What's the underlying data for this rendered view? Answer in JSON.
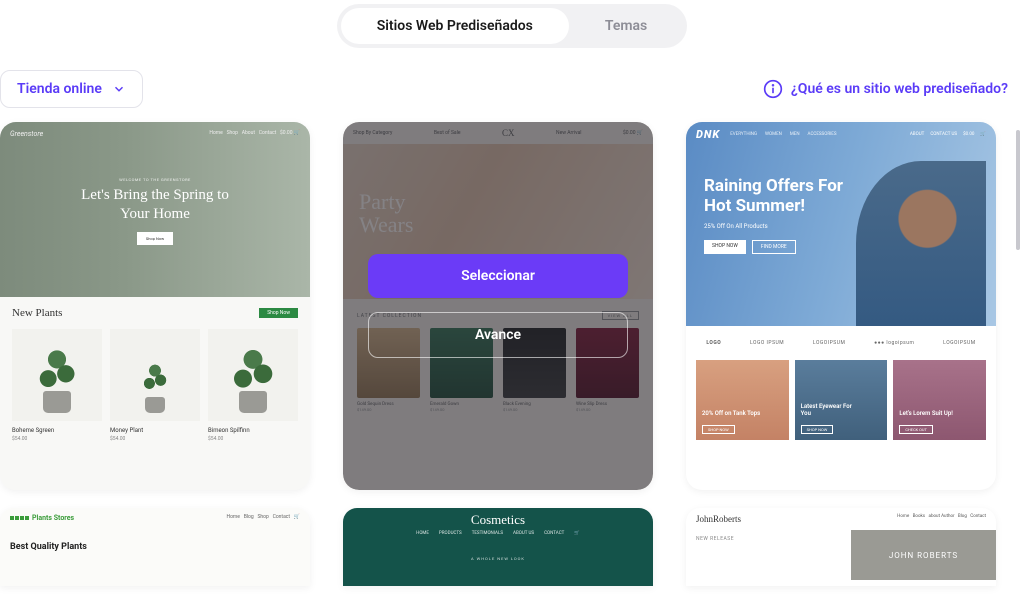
{
  "tabs": {
    "predesigned": "Sitios Web Prediseñados",
    "themes": "Temas"
  },
  "filter": {
    "label": "Tienda online"
  },
  "help": {
    "label": "¿Qué es un sitio web prediseñado?"
  },
  "overlay": {
    "select": "Seleccionar",
    "preview": "Avance"
  },
  "t1": {
    "logo": "Greenstore",
    "nav": [
      "Home",
      "Shop",
      "About",
      "Contact"
    ],
    "eyebrow": "WELCOME TO THE GREENSTORE",
    "title_l1": "Let's Bring the Spring to",
    "title_l2": "Your Home",
    "btn": "Shop Now",
    "section": "New Plants",
    "shop": "Shop Now",
    "p1": "Boheme Sgreen",
    "p2": "Money Plant",
    "p3": "Bimeon Spilfinn",
    "price": "$54.00"
  },
  "t2": {
    "nav_l": "Shop By Category",
    "nav_m": "Best of Sale",
    "nav_r": "New Arrival",
    "logo": "CX",
    "hero_l1": "Party",
    "hero_l2": "Wears",
    "section": "LATEST COLLECTION",
    "viewall": "VIEW ALL",
    "items": [
      "Gold Sequin Dress",
      "Emerald Gown",
      "Black Evening",
      "Wine Slip Dress"
    ],
    "price": "$149.00"
  },
  "t3": {
    "logo": "DNK",
    "nav": [
      "EVERYTHING",
      "WOMEN",
      "MEN",
      "ACCESSORIES"
    ],
    "nav_r": [
      "ABOUT",
      "CONTACT US",
      "$0.00"
    ],
    "hero_l1": "Raining Offers For",
    "hero_l2": "Hot Summer!",
    "hero_sub": "25% Off On All Products",
    "b1": "SHOP NOW",
    "b2": "FIND MORE",
    "logos": [
      "LOGO",
      "LOGO IPSUM",
      "LOGOIPSUM",
      "●●● logoipsum",
      "LOGOIPSUM"
    ],
    "c1_t": "20% Off on Tank Tops",
    "c2_t1": "Latest Eyewear For",
    "c2_t2": "You",
    "c3_t": "Let's Lorem Suit Up!",
    "mbtn": "SHOP NOW",
    "mbtn3": "CHECK OUT"
  },
  "t4": {
    "logo": "Plants Stores",
    "nav": [
      "Home",
      "Blog",
      "Shop",
      "Contact"
    ],
    "head": "Best Quality Plants"
  },
  "t5": {
    "logo": "Cosmetics",
    "nav": [
      "HOME",
      "PRODUCTS",
      "TESTIMONIALS",
      "ABOUT US",
      "CONTACT"
    ],
    "eyebrow": "A WHOLE NEW LOOK"
  },
  "t6": {
    "logo": "JohnRoberts",
    "nav": [
      "Home",
      "Books",
      "about Author",
      "Blog",
      "Contact"
    ],
    "section": "NEW RELEASE",
    "name": "JOHN ROBERTS"
  }
}
